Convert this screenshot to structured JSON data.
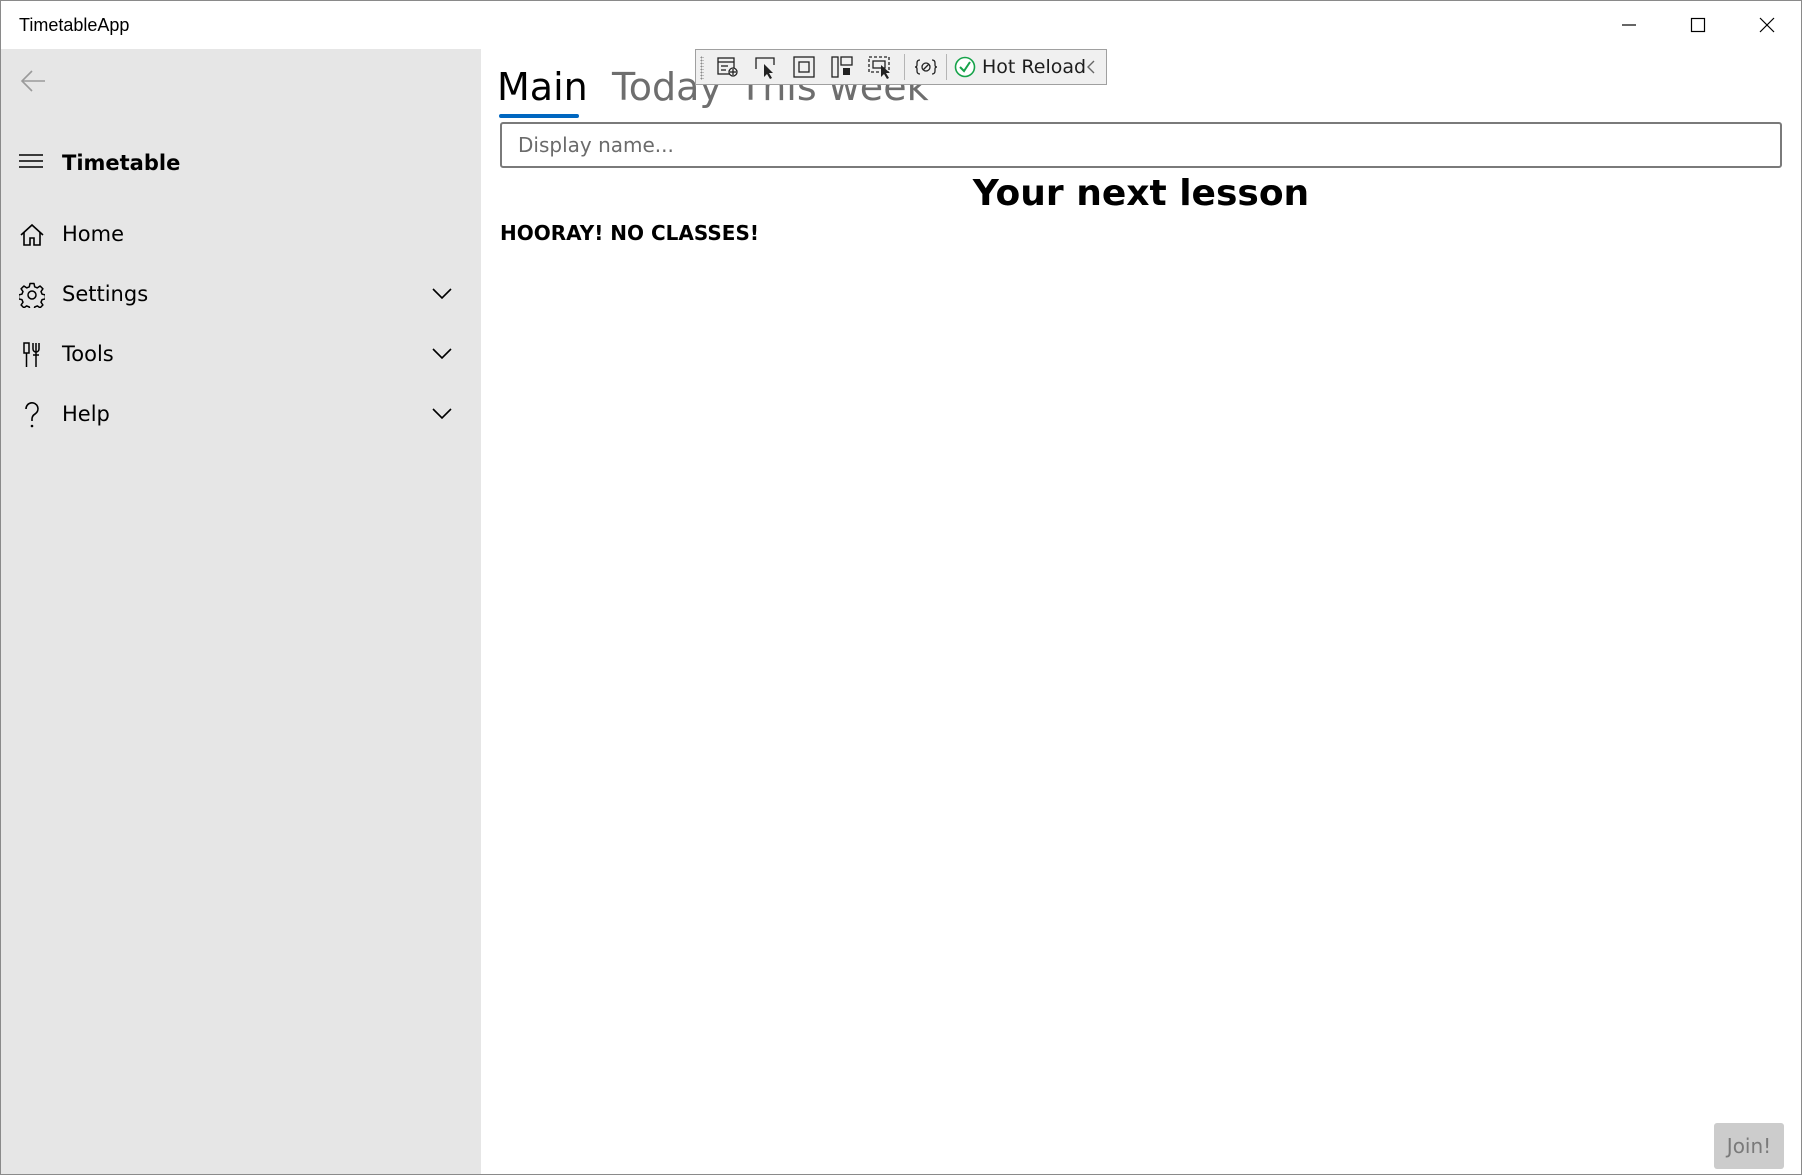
{
  "window": {
    "title": "TimetableApp"
  },
  "sidebar": {
    "header_title": "Timetable",
    "items": [
      {
        "label": "Home",
        "icon": "home-icon",
        "expandable": false
      },
      {
        "label": "Settings",
        "icon": "gear-icon",
        "expandable": true
      },
      {
        "label": "Tools",
        "icon": "tools-icon",
        "expandable": true
      },
      {
        "label": "Help",
        "icon": "question-icon",
        "expandable": true
      }
    ]
  },
  "tabs": [
    {
      "label": "Main",
      "selected": true
    },
    {
      "label": "Today",
      "selected": false
    },
    {
      "label": "This week",
      "selected": false
    }
  ],
  "main": {
    "display_name_placeholder": "Display name...",
    "display_name_value": "",
    "heading": "Your next lesson",
    "status": "HOORAY! NO CLASSES!",
    "join_label": "Join!",
    "join_enabled": false
  },
  "debug_toolbar": {
    "tools": [
      "go-to-live-visual-tree-icon",
      "select-element-icon",
      "display-layout-adorners-icon",
      "track-focus-icon",
      "in-app-selection-icon",
      "binding-failures-icon"
    ],
    "hot_reload_label": "Hot Reload",
    "hot_reload_status": "ok"
  },
  "colors": {
    "accent": "#0067c0",
    "sidebar_bg": "#e6e6e6",
    "join_disabled_bg": "#cccccc",
    "hot_reload_ok": "#16a34a"
  }
}
